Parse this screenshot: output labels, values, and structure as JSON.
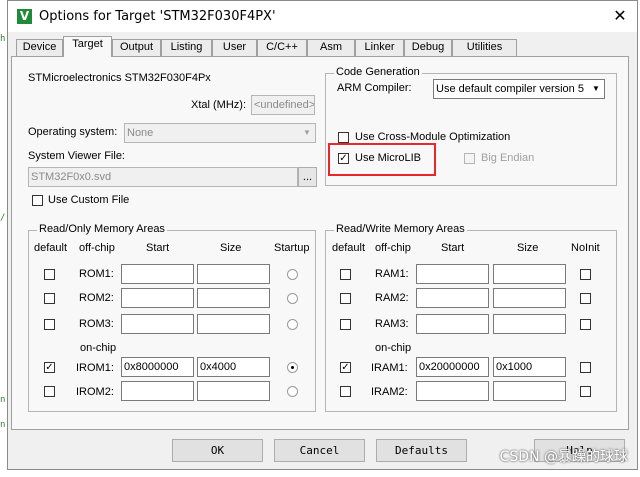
{
  "window": {
    "title": "Options for Target 'STM32F030F4PX'",
    "close": "✕"
  },
  "tabs": [
    {
      "label": "Device"
    },
    {
      "label": "Target",
      "active": true
    },
    {
      "label": "Output"
    },
    {
      "label": "Listing"
    },
    {
      "label": "User"
    },
    {
      "label": "C/C++"
    },
    {
      "label": "Asm"
    },
    {
      "label": "Linker"
    },
    {
      "label": "Debug"
    },
    {
      "label": "Utilities"
    }
  ],
  "target": {
    "device_name": "STMicroelectronics STM32F030F4Px",
    "xtal_label": "Xtal (MHz):",
    "xtal_value": "<undefined>",
    "os_label": "Operating system:",
    "os_value": "None",
    "svd_label": "System Viewer File:",
    "svd_value": "STM32F0x0.svd",
    "svd_browse": "...",
    "custom_file_label": "Use Custom File",
    "custom_file_checked": false
  },
  "codegen": {
    "legend": "Code Generation",
    "arm_compiler_label": "ARM Compiler:",
    "arm_compiler_value": "Use default compiler version 5",
    "cross_module_label": "Use Cross-Module Optimization",
    "cross_module_checked": false,
    "microlib_label": "Use MicroLIB",
    "microlib_checked": true,
    "big_endian_label": "Big Endian",
    "big_endian_checked": false
  },
  "rom": {
    "legend": "Read/Only Memory Areas",
    "headers": {
      "default": "default",
      "offchip": "off-chip",
      "start": "Start",
      "size": "Size",
      "last": "Startup"
    },
    "onchip_label": "on-chip",
    "rows": [
      {
        "name": "ROM1:",
        "default": false,
        "start": "",
        "size": "",
        "startup": false
      },
      {
        "name": "ROM2:",
        "default": false,
        "start": "",
        "size": "",
        "startup": false
      },
      {
        "name": "ROM3:",
        "default": false,
        "start": "",
        "size": "",
        "startup": false
      },
      {
        "name": "IROM1:",
        "default": true,
        "start": "0x8000000",
        "size": "0x4000",
        "startup": true
      },
      {
        "name": "IROM2:",
        "default": false,
        "start": "",
        "size": "",
        "startup": false
      }
    ]
  },
  "ram": {
    "legend": "Read/Write Memory Areas",
    "headers": {
      "default": "default",
      "offchip": "off-chip",
      "start": "Start",
      "size": "Size",
      "last": "NoInit"
    },
    "onchip_label": "on-chip",
    "rows": [
      {
        "name": "RAM1:",
        "default": false,
        "start": "",
        "size": "",
        "noinit": false
      },
      {
        "name": "RAM2:",
        "default": false,
        "start": "",
        "size": "",
        "noinit": false
      },
      {
        "name": "RAM3:",
        "default": false,
        "start": "",
        "size": "",
        "noinit": false
      },
      {
        "name": "IRAM1:",
        "default": true,
        "start": "0x20000000",
        "size": "0x1000",
        "noinit": false
      },
      {
        "name": "IRAM2:",
        "default": false,
        "start": "",
        "size": "",
        "noinit": false
      }
    ]
  },
  "buttons": {
    "ok": "OK",
    "cancel": "Cancel",
    "defaults": "Defaults",
    "help": "Help"
  },
  "watermark": "CSDN @暴躁的球球",
  "colors": {
    "highlight": "#e8262b",
    "app_icon": "#1f8a3a"
  },
  "icons": {
    "app": "keil-logo-icon",
    "close": "close-icon",
    "dropdown": "chevron-down-icon",
    "check": "check-icon"
  },
  "residue": {
    "a": "h",
    "b": "/",
    "c": "n",
    "d": "n"
  }
}
